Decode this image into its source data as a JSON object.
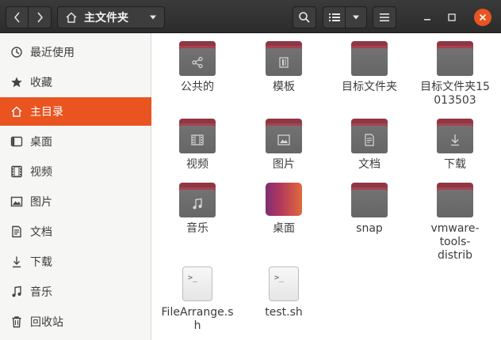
{
  "header": {
    "path_label": "主文件夹"
  },
  "sidebar": {
    "items": [
      {
        "label": "最近使用",
        "icon": "clock-icon"
      },
      {
        "label": "收藏",
        "icon": "star-icon"
      },
      {
        "label": "主目录",
        "icon": "home-icon",
        "active": true
      },
      {
        "label": "桌面",
        "icon": "desktop-icon"
      },
      {
        "label": "视频",
        "icon": "film-icon"
      },
      {
        "label": "图片",
        "icon": "image-icon"
      },
      {
        "label": "文档",
        "icon": "document-icon"
      },
      {
        "label": "下载",
        "icon": "download-icon"
      },
      {
        "label": "音乐",
        "icon": "music-icon"
      },
      {
        "label": "回收站",
        "icon": "trash-icon"
      }
    ]
  },
  "files": [
    {
      "name": "公共的",
      "type": "folder",
      "emblem": "share-icon"
    },
    {
      "name": "模板",
      "type": "folder",
      "emblem": "template-icon"
    },
    {
      "name": "目标文件夹",
      "type": "folder",
      "emblem": ""
    },
    {
      "name": "目标文件夹15013503",
      "type": "folder",
      "emblem": ""
    },
    {
      "name": "视频",
      "type": "folder",
      "emblem": "film-icon"
    },
    {
      "name": "图片",
      "type": "folder",
      "emblem": "image-icon"
    },
    {
      "name": "文档",
      "type": "folder",
      "emblem": "document-icon"
    },
    {
      "name": "下载",
      "type": "folder",
      "emblem": "download-icon"
    },
    {
      "name": "音乐",
      "type": "folder",
      "emblem": "music-icon"
    },
    {
      "name": "桌面",
      "type": "desktop",
      "emblem": ""
    },
    {
      "name": "snap",
      "type": "folder",
      "emblem": ""
    },
    {
      "name": "vmware-tools-distrib",
      "type": "folder",
      "emblem": ""
    },
    {
      "name": "FileArrange.sh",
      "type": "script",
      "emblem": "terminal-icon"
    },
    {
      "name": "test.sh",
      "type": "script",
      "emblem": "terminal-icon"
    }
  ],
  "colors": {
    "accent": "#e95420",
    "folder_tab": "#a5434f",
    "folder_body": "#6e6e6e"
  }
}
